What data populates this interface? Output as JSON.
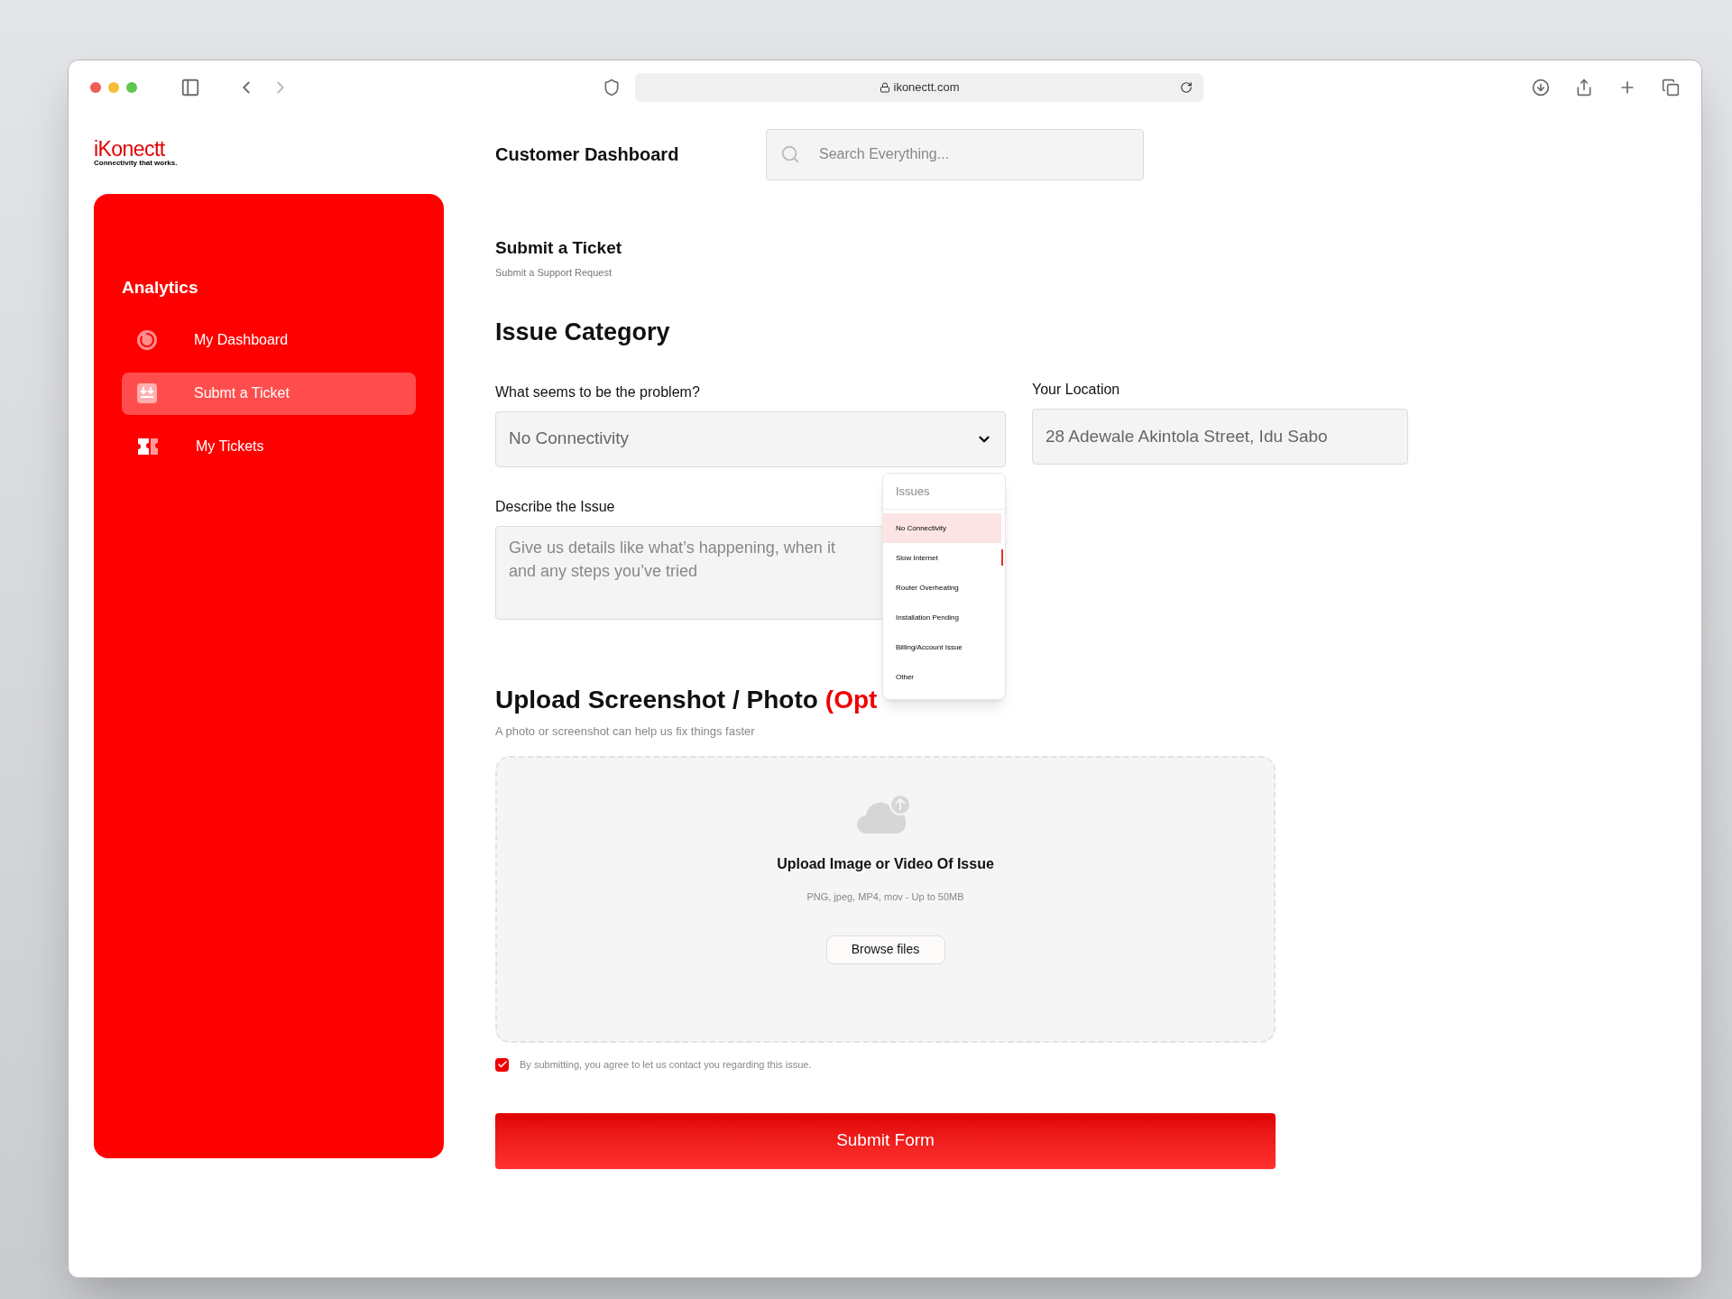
{
  "browser": {
    "url": "ikonectt.com"
  },
  "logo": {
    "name": "iKonectt",
    "tagline": "Connectivity that works."
  },
  "header": {
    "title": "Customer Dashboard",
    "search": {
      "placeholder": "Search Everything..."
    }
  },
  "sidebar": {
    "section": "Analytics",
    "items": [
      {
        "label": "My Dashboard",
        "selected": false
      },
      {
        "label": "Submt a Ticket",
        "selected": true
      },
      {
        "label": "My  Tickets",
        "selected": false
      }
    ]
  },
  "page": {
    "title": "Submit a Ticket",
    "subtitle": "Submit a Support Request"
  },
  "form": {
    "heading": "Issue Category",
    "problem": {
      "label": "What seems to be the problem?",
      "value": "No Connectivity",
      "expanded": true
    },
    "location": {
      "label": "Your Location",
      "value": "28 Adewale Akintola Street, Idu Sabo"
    },
    "description": {
      "label": "Describe the Issue",
      "placeholder": "Give us details like what’s happening, when it\nand any steps you’ve tried"
    },
    "dropdown": {
      "header": "Issues",
      "items": [
        {
          "label": "No Connectivity",
          "selected": true
        },
        {
          "label": "Slow Internet",
          "selected": false
        },
        {
          "label": "Router Overheating",
          "selected": false
        },
        {
          "label": "Installation Pending",
          "selected": false
        },
        {
          "label": "Billing/Account Issue",
          "selected": false
        },
        {
          "label": "Other",
          "selected": false
        }
      ]
    }
  },
  "upload": {
    "heading": "Upload Screenshot / Photo",
    "optional": "(Opt",
    "subtitle": "A photo or screenshot can help us fix things faster",
    "title": "Upload Image or Video Of Issue",
    "hint": "PNG, jpeg, MP4, mov - Up to 50MB",
    "button": "Browse files"
  },
  "consent": {
    "label": "By submitting, you agree to let us contact you regarding this issue.",
    "checked": true
  },
  "submit": {
    "label": "Submit Form"
  }
}
